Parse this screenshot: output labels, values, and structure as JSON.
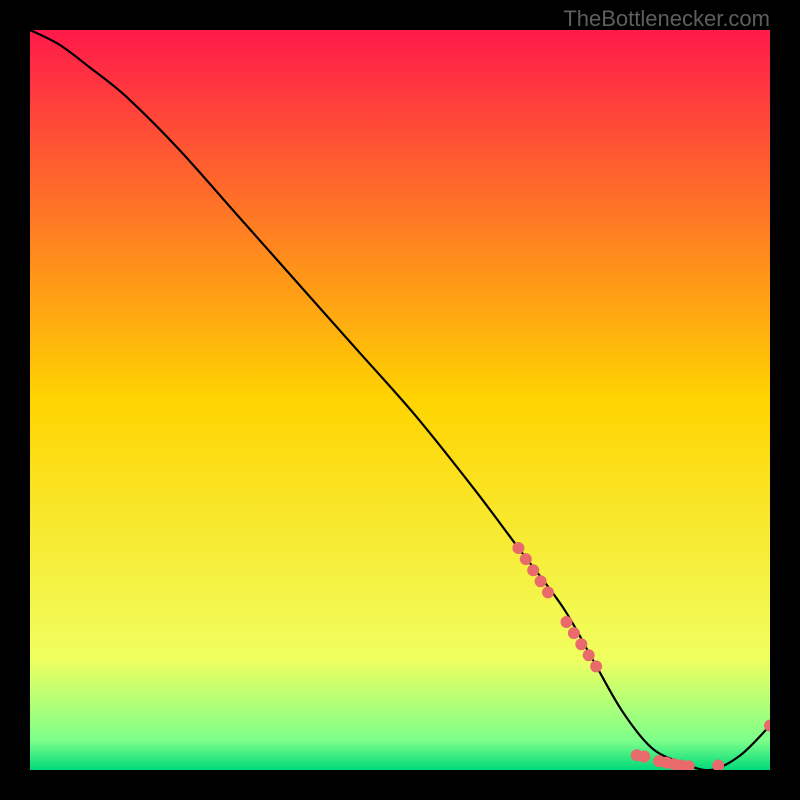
{
  "attribution": "TheBottlenecker.com",
  "chart_data": {
    "type": "line",
    "title": "",
    "xlabel": "",
    "ylabel": "",
    "xlim": [
      0,
      100
    ],
    "ylim": [
      0,
      100
    ],
    "gradient_stops": [
      {
        "offset": 0,
        "color": "#ff1a4a"
      },
      {
        "offset": 50,
        "color": "#ffd400"
      },
      {
        "offset": 85,
        "color": "#f0ff60"
      },
      {
        "offset": 96,
        "color": "#7dff8a"
      },
      {
        "offset": 100,
        "color": "#00d97a"
      }
    ],
    "series": [
      {
        "name": "bottleneck-curve",
        "x": [
          0,
          4,
          8,
          13,
          20,
          28,
          36,
          44,
          52,
          60,
          66,
          72,
          76,
          80,
          84,
          88,
          92,
          96,
          100
        ],
        "y": [
          100,
          98,
          95,
          91,
          84,
          75,
          66,
          57,
          48,
          38,
          30,
          22,
          15,
          8,
          3,
          1,
          0,
          2,
          6
        ]
      }
    ],
    "markers": {
      "name": "highlight-points",
      "color": "#e86a6a",
      "radius": 6,
      "points": [
        {
          "x": 66,
          "y": 30
        },
        {
          "x": 67,
          "y": 28.5
        },
        {
          "x": 68,
          "y": 27
        },
        {
          "x": 69,
          "y": 25.5
        },
        {
          "x": 70,
          "y": 24
        },
        {
          "x": 72.5,
          "y": 20
        },
        {
          "x": 73.5,
          "y": 18.5
        },
        {
          "x": 74.5,
          "y": 17
        },
        {
          "x": 75.5,
          "y": 15.5
        },
        {
          "x": 76.5,
          "y": 14
        },
        {
          "x": 82,
          "y": 2
        },
        {
          "x": 83,
          "y": 1.8
        },
        {
          "x": 85,
          "y": 1.2
        },
        {
          "x": 86,
          "y": 1
        },
        {
          "x": 87,
          "y": 0.8
        },
        {
          "x": 88,
          "y": 0.6
        },
        {
          "x": 89,
          "y": 0.5
        },
        {
          "x": 93,
          "y": 0.6
        },
        {
          "x": 100,
          "y": 6
        }
      ]
    }
  }
}
